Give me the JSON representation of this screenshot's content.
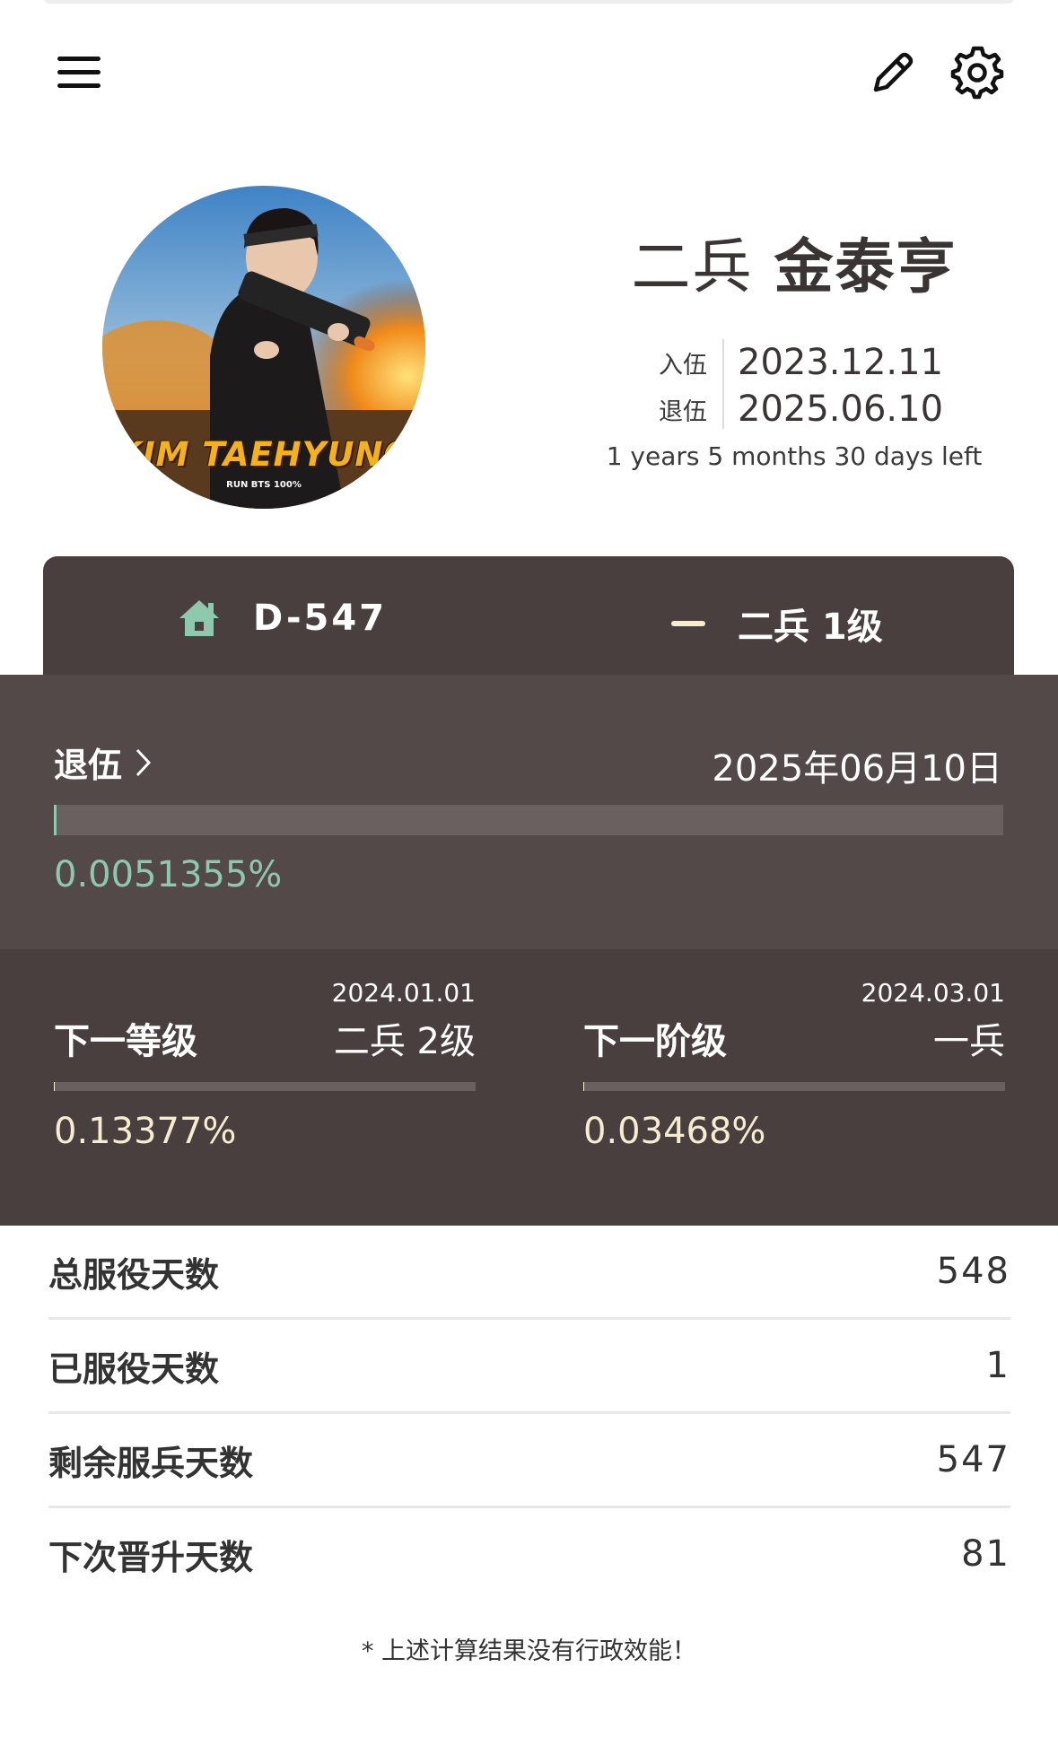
{
  "header": {
    "menu_icon": "hamburger-menu-icon",
    "edit_icon": "pencil-icon",
    "settings_icon": "gear-icon"
  },
  "profile": {
    "avatar_text": "KIM TAEHYUNG",
    "avatar_subtext": "RUN BTS 100%",
    "rank": "二兵",
    "name": "金泰亨",
    "enlist_label": "入伍",
    "enlist_date": "2023.12.11",
    "discharge_label": "退伍",
    "discharge_date": "2025.06.10",
    "time_left": "1 years 5 months 30 days left"
  },
  "dday_bar": {
    "home_icon": "home-icon",
    "dday": "D-547",
    "grade_icon": "rank-stripe-icon",
    "grade": "二兵 1级"
  },
  "discharge_progress": {
    "title": "退伍",
    "date": "2025年06月10日",
    "percent_text": "0.0051355%",
    "percent": 0.0051355
  },
  "next_grade": {
    "title": "下一等级",
    "date": "2024.01.01",
    "target": "二兵 2级",
    "percent_text": "0.13377%",
    "percent": 0.13377
  },
  "next_stage": {
    "title": "下一阶级",
    "date": "2024.03.01",
    "target": "一兵",
    "percent_text": "0.03468%",
    "percent": 0.03468
  },
  "stats": [
    {
      "label": "总服役天数",
      "value": "548"
    },
    {
      "label": "已服役天数",
      "value": "1"
    },
    {
      "label": "剩余服兵天数",
      "value": "547"
    },
    {
      "label": "下次晋升天数",
      "value": "81"
    }
  ],
  "note": "* 上述计算结果没有行政效能！",
  "colors": {
    "dark_panel": "#4a3f3f",
    "mid_panel": "#544949",
    "mint": "#8fc9ad",
    "cream": "#f6ecd0"
  }
}
